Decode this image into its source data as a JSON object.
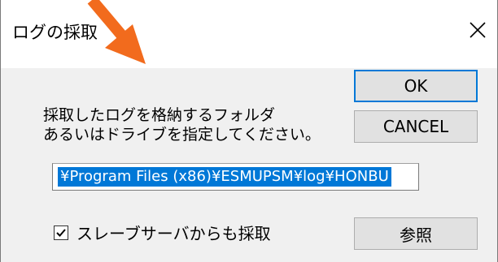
{
  "window": {
    "title": "ログの採取",
    "close_icon": "close-icon"
  },
  "buttons": {
    "ok_label": "OK",
    "cancel_label": "CANCEL",
    "browse_label": "参照"
  },
  "instructions": {
    "line1": "採取したログを格納するフォルダ",
    "line2": "あるいはドライブを指定してください。"
  },
  "path_field": {
    "value": "¥Program Files (x86)¥ESMUPSM¥log¥HONBU",
    "selected": true
  },
  "slave_checkbox": {
    "label": "スレーブサーバからも採取",
    "checked": true
  },
  "overlay": {
    "arrow_icon": "pointer-arrow-icon",
    "arrow_color": "#f26b1d"
  },
  "colors": {
    "accent": "#0078d7",
    "dialog_bg": "#f0f0f0",
    "title_bg": "#ffffff"
  }
}
